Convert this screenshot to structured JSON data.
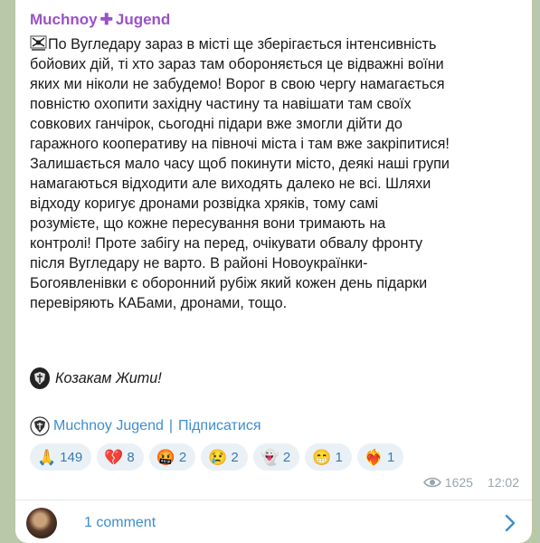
{
  "post": {
    "channel_name": "Muchnoy",
    "channel_name_suffix": "Jugend",
    "plus_symbol": "✚",
    "body": "По Вугледару зараз в місті ще зберігається інтенсивність\nбойових дій, ті хто зараз там обороняється це відважні воїни\nяких ми ніколи не забудемо! Ворог в свою чергу намагається\nповністю охопити західну частину та навішати там своїх\nсовкових ганчірок, сьогодні підари вже змогли дійти до\nгаражного кооперативу на півночі міста і там вже закріпитися!\nЗалишається мало часу щоб покинути місто, деякі наші групи\nнамагаються відходити але виходять далеко не всі. Шляхи\nвідходу коригує дронами розвідка хряків, тому самі\nрозумієте, що кожне пересування вони тримають на\nконтролі! Проте забігу на перед, очікувати обвалу фронту\nпісля Вугледару не варто. В районі Новоукраїнки-\nБогоявленівки є оборонний рубіж який кожен день підарки\nперевіряють КАБами, дронами, тощо.",
    "signoff": "Козакам Жити!",
    "link_channel": "Muchnoy Jugend",
    "link_separator": "|",
    "link_subscribe": "Підписатися",
    "views": "1625",
    "time": "12:02",
    "comments_label": "1 comment"
  },
  "reactions": [
    {
      "emoji": "🙏",
      "count": "149"
    },
    {
      "emoji": "💔",
      "count": "8"
    },
    {
      "emoji": "🤬",
      "count": "2"
    },
    {
      "emoji": "😢",
      "count": "2"
    },
    {
      "emoji": "👻",
      "count": "2"
    },
    {
      "emoji": "😁",
      "count": "1"
    },
    {
      "emoji": "❤️‍🔥",
      "count": "1"
    }
  ],
  "colors": {
    "accent": "#9a52c8",
    "link": "#3f8dcf",
    "background": "#b9c8a8"
  }
}
